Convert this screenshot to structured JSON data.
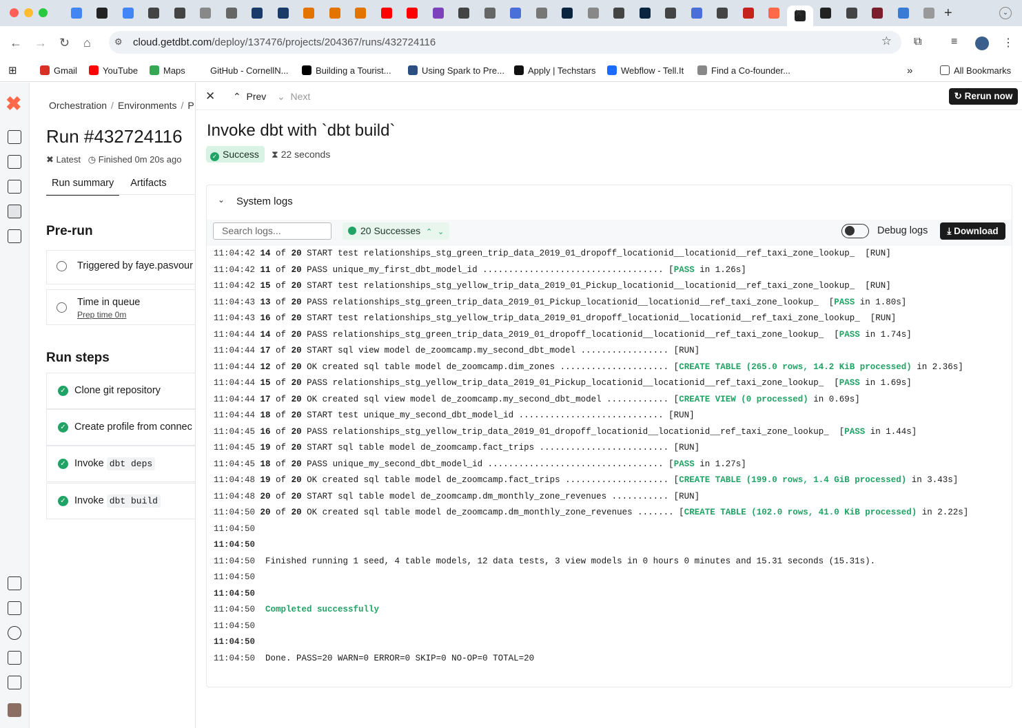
{
  "browser": {
    "url_host": "cloud.getdbt.com",
    "url_path": "/deploy/137476/projects/204367/runs/432724116",
    "bookmarks": [
      "Gmail",
      "YouTube",
      "Maps",
      "GitHub - CornellN...",
      "Building a Tourist...",
      "Using Spark to Pre...",
      "Apply | Techstars",
      "Webflow - Tell.It",
      "Find a Co-founder..."
    ],
    "bookmark_colors": [
      "#d93025",
      "#ff0000",
      "#34a853",
      "#000000",
      "#000000",
      "#2b4f81",
      "#111111",
      "#1c6bff",
      "#888888"
    ],
    "all_bookmarks": "All Bookmarks"
  },
  "left": {
    "breadcrumb": [
      "Orchestration",
      "Environments",
      "P"
    ],
    "run_title": "Run #432724116",
    "latest": "Latest",
    "finished": "Finished 0m 20s ago",
    "tabs": [
      "Run summary",
      "Artifacts"
    ],
    "prerun_title": "Pre-run",
    "triggered": "Triggered by faye.pasvour",
    "time_in_queue": "Time in queue",
    "prep_time": "Prep time 0m",
    "steps_title": "Run steps",
    "steps": [
      {
        "text": "Clone git repository",
        "code": ""
      },
      {
        "text": "Create profile from connec",
        "code": ""
      },
      {
        "text": "Invoke",
        "code": "dbt deps"
      },
      {
        "text": "Invoke",
        "code": "dbt build"
      }
    ]
  },
  "detail": {
    "prev": "Prev",
    "next": "Next",
    "rerun": "Rerun now",
    "title": "Invoke dbt with `dbt build`",
    "status": "Success",
    "duration": "22 seconds",
    "logs_label": "System logs",
    "search_placeholder": "Search logs...",
    "successes": "20 Successes",
    "debug_logs": "Debug logs",
    "download": "Download"
  },
  "logs": [
    {
      "ts": "11:04:42",
      "n": "14",
      "t": "20",
      "body": "START test relationships_stg_green_trip_data_2019_01_dropoff_locationid__locationid__ref_taxi_zone_lookup_  [RUN]",
      "hl": ""
    },
    {
      "ts": "11:04:42",
      "n": "11",
      "t": "20",
      "body": "PASS unique_my_first_dbt_model_id ................................... [",
      "hl": "PASS",
      "tail": " in 1.26s]"
    },
    {
      "ts": "11:04:42",
      "n": "15",
      "t": "20",
      "body": "START test relationships_stg_yellow_trip_data_2019_01_Pickup_locationid__locationid__ref_taxi_zone_lookup_  [RUN]",
      "hl": ""
    },
    {
      "ts": "11:04:43",
      "n": "13",
      "t": "20",
      "body": "PASS relationships_stg_green_trip_data_2019_01_Pickup_locationid__locationid__ref_taxi_zone_lookup_  [",
      "hl": "PASS",
      "tail": " in 1.80s]"
    },
    {
      "ts": "11:04:43",
      "n": "16",
      "t": "20",
      "body": "START test relationships_stg_yellow_trip_data_2019_01_dropoff_locationid__locationid__ref_taxi_zone_lookup_  [RUN]",
      "hl": ""
    },
    {
      "ts": "11:04:44",
      "n": "14",
      "t": "20",
      "body": "PASS relationships_stg_green_trip_data_2019_01_dropoff_locationid__locationid__ref_taxi_zone_lookup_  [",
      "hl": "PASS",
      "tail": " in 1.74s]"
    },
    {
      "ts": "11:04:44",
      "n": "17",
      "t": "20",
      "body": "START sql view model de_zoomcamp.my_second_dbt_model ................. [RUN]",
      "hl": ""
    },
    {
      "ts": "11:04:44",
      "n": "12",
      "t": "20",
      "body": "OK created sql table model de_zoomcamp.dim_zones ..................... [",
      "hl": "CREATE TABLE (265.0 rows, 14.2 KiB processed)",
      "tail": " in 2.36s]"
    },
    {
      "ts": "11:04:44",
      "n": "15",
      "t": "20",
      "body": "PASS relationships_stg_yellow_trip_data_2019_01_Pickup_locationid__locationid__ref_taxi_zone_lookup_  [",
      "hl": "PASS",
      "tail": " in 1.69s]"
    },
    {
      "ts": "11:04:44",
      "n": "17",
      "t": "20",
      "body": "OK created sql view model de_zoomcamp.my_second_dbt_model ............ [",
      "hl": "CREATE VIEW (0 processed)",
      "tail": " in 0.69s]"
    },
    {
      "ts": "11:04:44",
      "n": "18",
      "t": "20",
      "body": "START test unique_my_second_dbt_model_id ............................ [RUN]",
      "hl": ""
    },
    {
      "ts": "11:04:45",
      "n": "16",
      "t": "20",
      "body": "PASS relationships_stg_yellow_trip_data_2019_01_dropoff_locationid__locationid__ref_taxi_zone_lookup_  [",
      "hl": "PASS",
      "tail": " in 1.44s]"
    },
    {
      "ts": "11:04:45",
      "n": "19",
      "t": "20",
      "body": "START sql table model de_zoomcamp.fact_trips ......................... [RUN]",
      "hl": ""
    },
    {
      "ts": "11:04:45",
      "n": "18",
      "t": "20",
      "body": "PASS unique_my_second_dbt_model_id .................................. [",
      "hl": "PASS",
      "tail": " in 1.27s]"
    },
    {
      "ts": "11:04:48",
      "n": "19",
      "t": "20",
      "body": "OK created sql table model de_zoomcamp.fact_trips .................... [",
      "hl": "CREATE TABLE (199.0 rows, 1.4 GiB processed)",
      "tail": " in 3.43s]"
    },
    {
      "ts": "11:04:48",
      "n": "20",
      "t": "20",
      "body": "START sql table model de_zoomcamp.dm_monthly_zone_revenues ........... [RUN]",
      "hl": ""
    },
    {
      "ts": "11:04:50",
      "n": "20",
      "t": "20",
      "body": "OK created sql table model de_zoomcamp.dm_monthly_zone_revenues ....... [",
      "hl": "CREATE TABLE (102.0 rows, 41.0 KiB processed)",
      "tail": " in 2.22s]"
    }
  ],
  "summary_lines": [
    {
      "ts": "11:04:50",
      "msg": "",
      "bold": false,
      "green": false
    },
    {
      "ts": "11:04:50",
      "msg": "",
      "bold": true,
      "green": false
    },
    {
      "ts": "11:04:50",
      "msg": "Finished running 1 seed, 4 table models, 12 data tests, 3 view models in 0 hours 0 minutes and 15.31 seconds (15.31s).",
      "bold": false,
      "green": false
    },
    {
      "ts": "11:04:50",
      "msg": "",
      "bold": false,
      "green": false
    },
    {
      "ts": "11:04:50",
      "msg": "",
      "bold": true,
      "green": false
    },
    {
      "ts": "11:04:50",
      "msg": "Completed successfully",
      "bold": false,
      "green": true
    },
    {
      "ts": "11:04:50",
      "msg": "",
      "bold": false,
      "green": false
    },
    {
      "ts": "11:04:50",
      "msg": "",
      "bold": true,
      "green": false
    },
    {
      "ts": "11:04:50",
      "msg": "Done. PASS=20 WARN=0 ERROR=0 SKIP=0 NO-OP=0 TOTAL=20",
      "bold": false,
      "green": false
    }
  ],
  "colors": {
    "success": "#21a366",
    "brand": "#ff694a",
    "dark_button": "#1b1b1b"
  }
}
